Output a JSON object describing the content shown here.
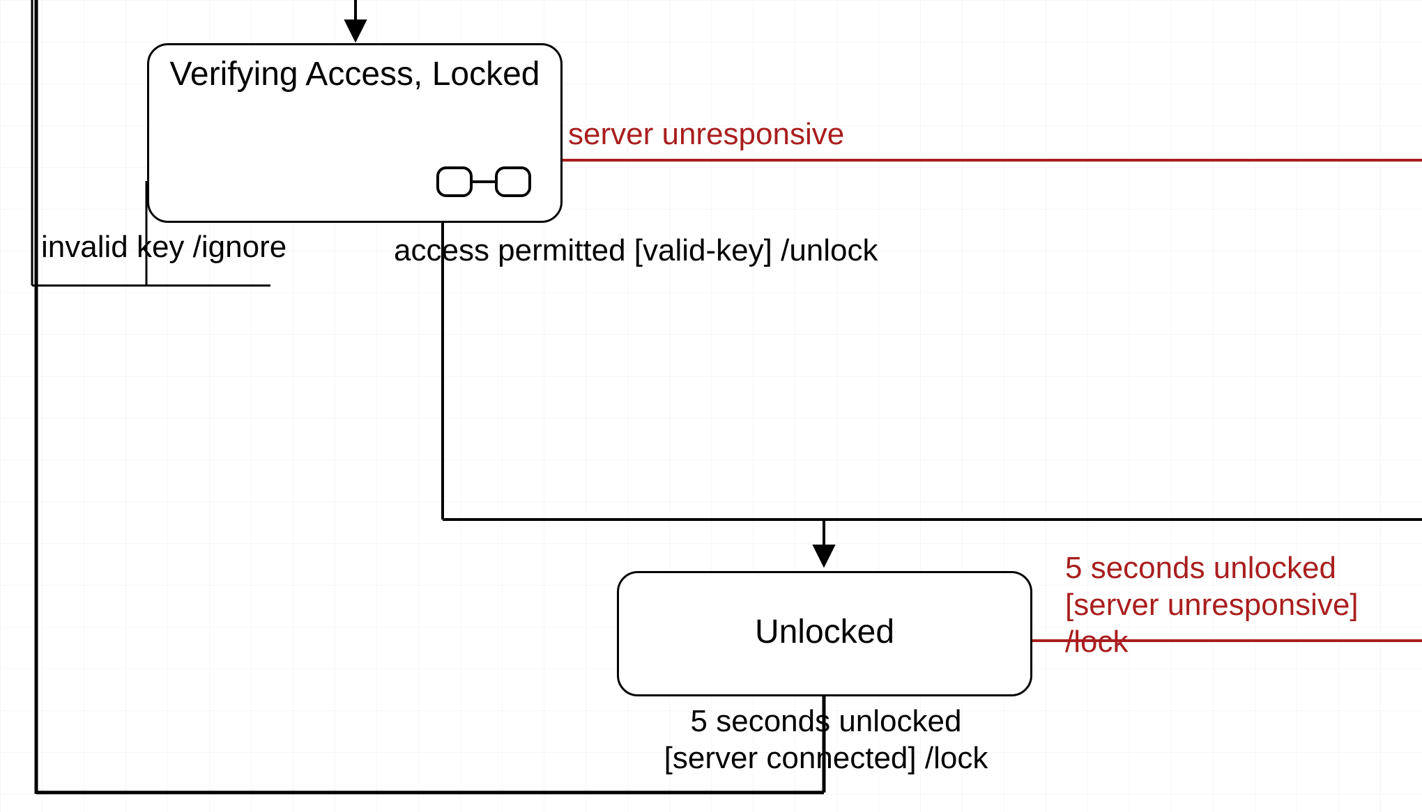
{
  "states": {
    "verifying": {
      "title": "Verifying Access, Locked"
    },
    "unlocked": {
      "title": "Unlocked"
    }
  },
  "transitions": {
    "server_unresponsive": {
      "label": "server unresponsive"
    },
    "invalid_key": {
      "label": "invalid key /ignore"
    },
    "access_permitted": {
      "label": "access permitted [valid-key] /unlock"
    },
    "five_sec_unresponsive": {
      "label": "5 seconds unlocked\n[server unresponsive] /lock"
    },
    "five_sec_connected": {
      "label": "5 seconds unlocked\n[server connected] /lock"
    }
  },
  "colors": {
    "red": "#a91e1e",
    "black": "#000000"
  }
}
